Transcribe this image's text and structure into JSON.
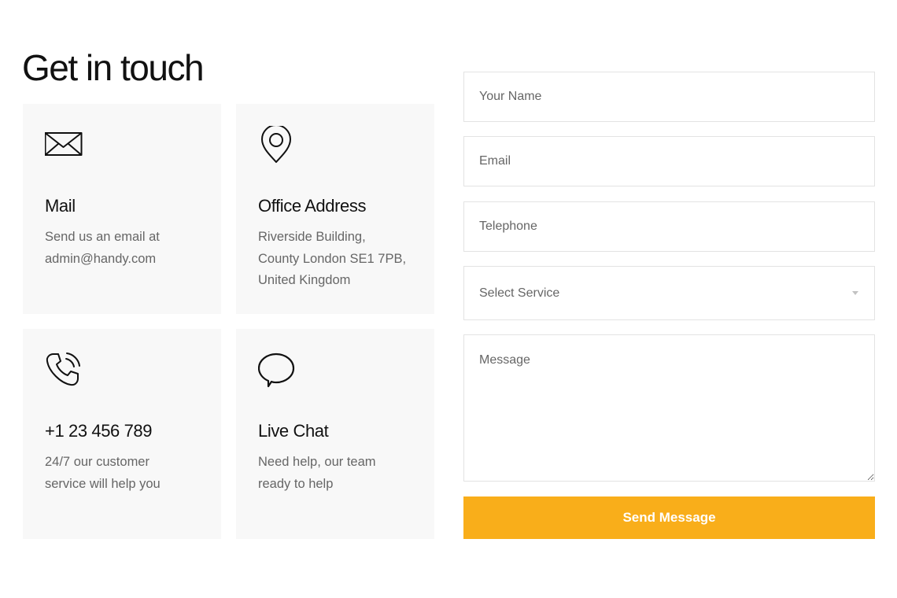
{
  "heading": "Get in touch",
  "cards": [
    {
      "icon": "envelope-icon",
      "title": "Mail",
      "lines": [
        "Send us an email at",
        "admin@handy.com"
      ]
    },
    {
      "icon": "map-pin-icon",
      "title": "Office Address",
      "lines": [
        "Riverside Building,",
        "County London SE1 7PB,",
        "United Kingdom"
      ]
    },
    {
      "icon": "phone-ringing-icon",
      "title": "+1 23 456 789",
      "lines": [
        "24/7 our customer",
        "service will help you"
      ]
    },
    {
      "icon": "speech-bubble-icon",
      "title": "Live Chat",
      "lines": [
        "Need help, our team",
        "ready to help"
      ]
    }
  ],
  "form": {
    "name_placeholder": "Your Name",
    "email_placeholder": "Email",
    "telephone_placeholder": "Telephone",
    "service_selected": "Select Service",
    "message_placeholder": "Message",
    "submit_label": "Send Message"
  },
  "colors": {
    "accent": "#f9ae1a",
    "card_background": "#f8f8f8",
    "field_border": "#e3e3e3",
    "body_text": "#666666",
    "heading_text": "#111111"
  }
}
